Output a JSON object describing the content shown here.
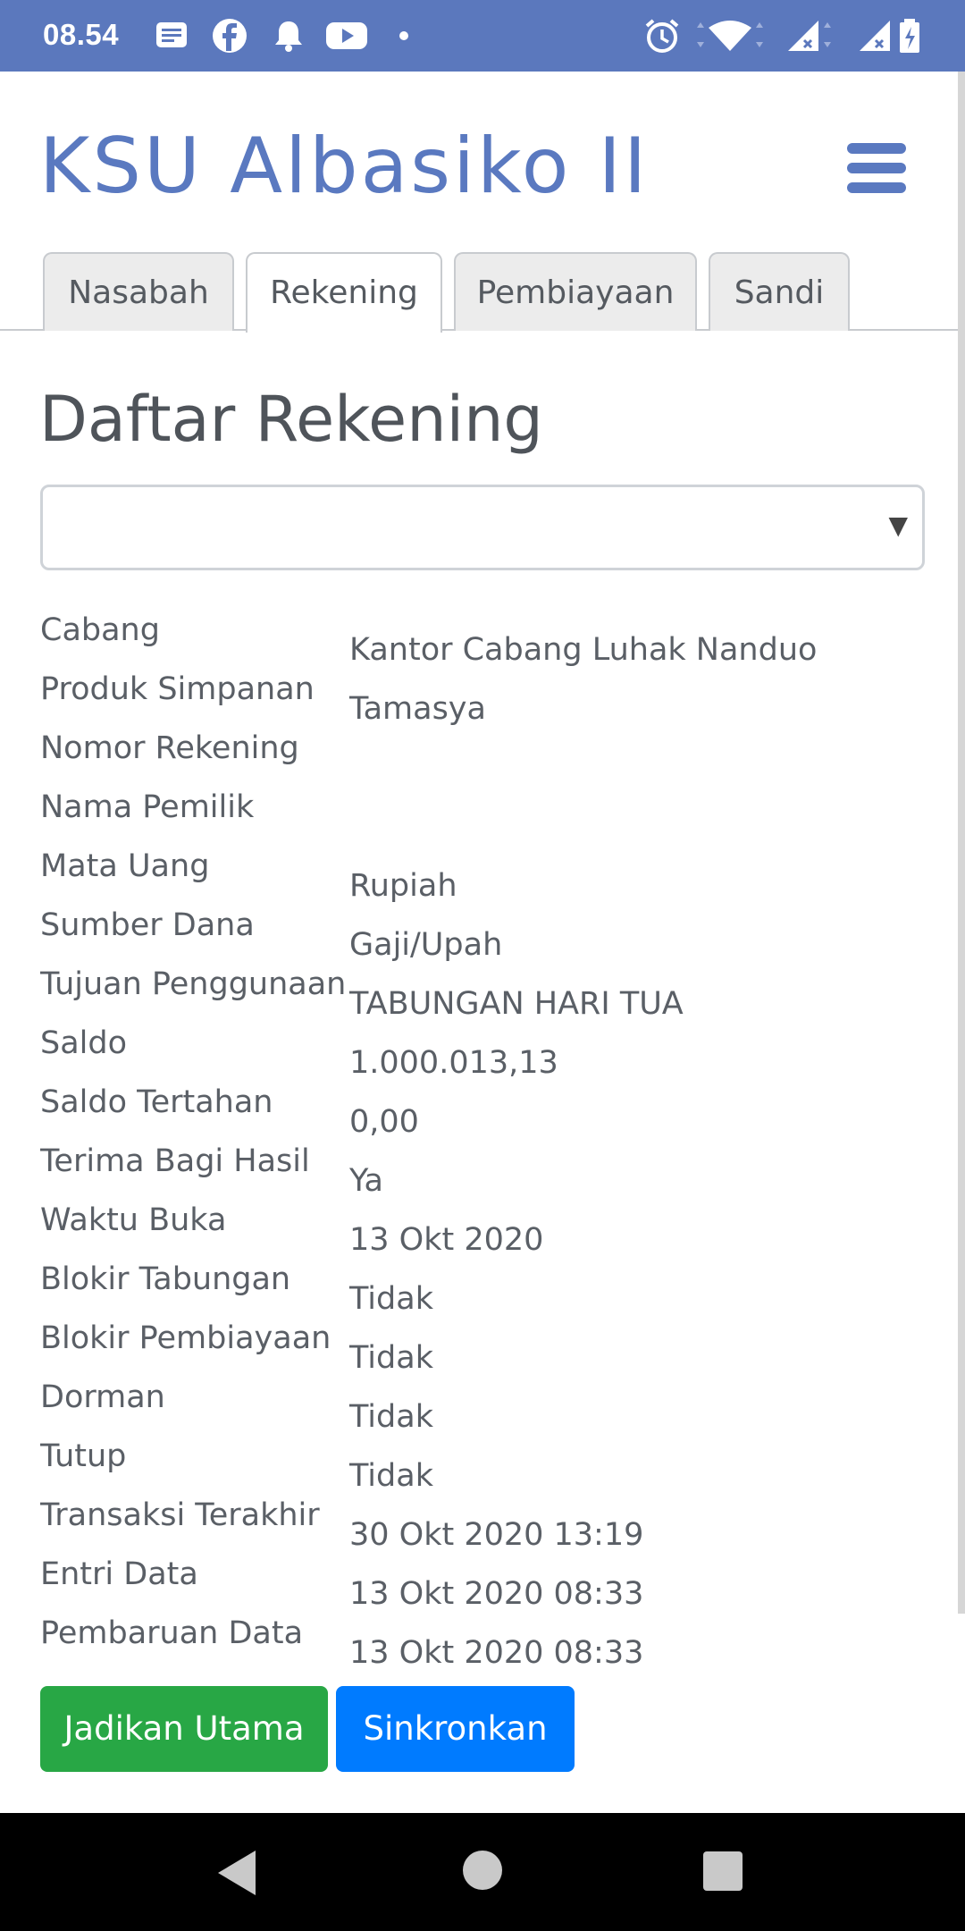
{
  "status_bar": {
    "time": "08.54",
    "icons": [
      "message-icon",
      "facebook-icon",
      "bell-icon",
      "youtube-icon",
      "dot-icon",
      "alarm-icon",
      "wifi-icon",
      "signal-icon",
      "signal-icon",
      "battery-icon"
    ]
  },
  "header": {
    "brand": "KSU Albasiko II",
    "menu_icon": "hamburger-icon",
    "brand_color": "#5a79c0"
  },
  "tabs": [
    {
      "label": "Nasabah",
      "active": false
    },
    {
      "label": "Rekening",
      "active": true
    },
    {
      "label": "Pembiayaan",
      "active": false
    },
    {
      "label": "Sandi",
      "active": false
    }
  ],
  "page_title": "Daftar Rekening",
  "account_select": {
    "value": "",
    "caret": "▼"
  },
  "details": [
    {
      "label": "Cabang",
      "value": "Kantor Cabang Luhak Nanduo"
    },
    {
      "label": "Produk Simpanan",
      "value": "Tamasya"
    },
    {
      "label": "Nomor Rekening",
      "value": ""
    },
    {
      "label": "Nama Pemilik",
      "value": ""
    },
    {
      "label": "Mata Uang",
      "value": "Rupiah"
    },
    {
      "label": "Sumber Dana",
      "value": "Gaji/Upah"
    },
    {
      "label": "Tujuan Penggunaan",
      "value": "TABUNGAN HARI TUA"
    },
    {
      "label": "Saldo",
      "value": "1.000.013,13"
    },
    {
      "label": "Saldo Tertahan",
      "value": "0,00"
    },
    {
      "label": "Terima Bagi Hasil",
      "value": "Ya"
    },
    {
      "label": "Waktu Buka",
      "value": "13 Okt 2020"
    },
    {
      "label": "Blokir Tabungan",
      "value": "Tidak"
    },
    {
      "label": "Blokir Pembiayaan",
      "value": "Tidak"
    },
    {
      "label": "Dorman",
      "value": "Tidak"
    },
    {
      "label": "Tutup",
      "value": "Tidak"
    },
    {
      "label": "Transaksi Terakhir",
      "value": "30 Okt 2020 13:19"
    },
    {
      "label": "Entri Data",
      "value": "13 Okt 2020 08:33"
    },
    {
      "label": "Pembaruan Data",
      "value": "13 Okt 2020 08:33"
    }
  ],
  "buttons": {
    "primary": {
      "label": "Jadikan Utama",
      "color": "#28a745"
    },
    "sync": {
      "label": "Sinkronkan",
      "color": "#007bff"
    }
  },
  "nav_bar": {
    "icons": [
      "back-icon",
      "home-icon",
      "recent-apps-icon"
    ]
  }
}
